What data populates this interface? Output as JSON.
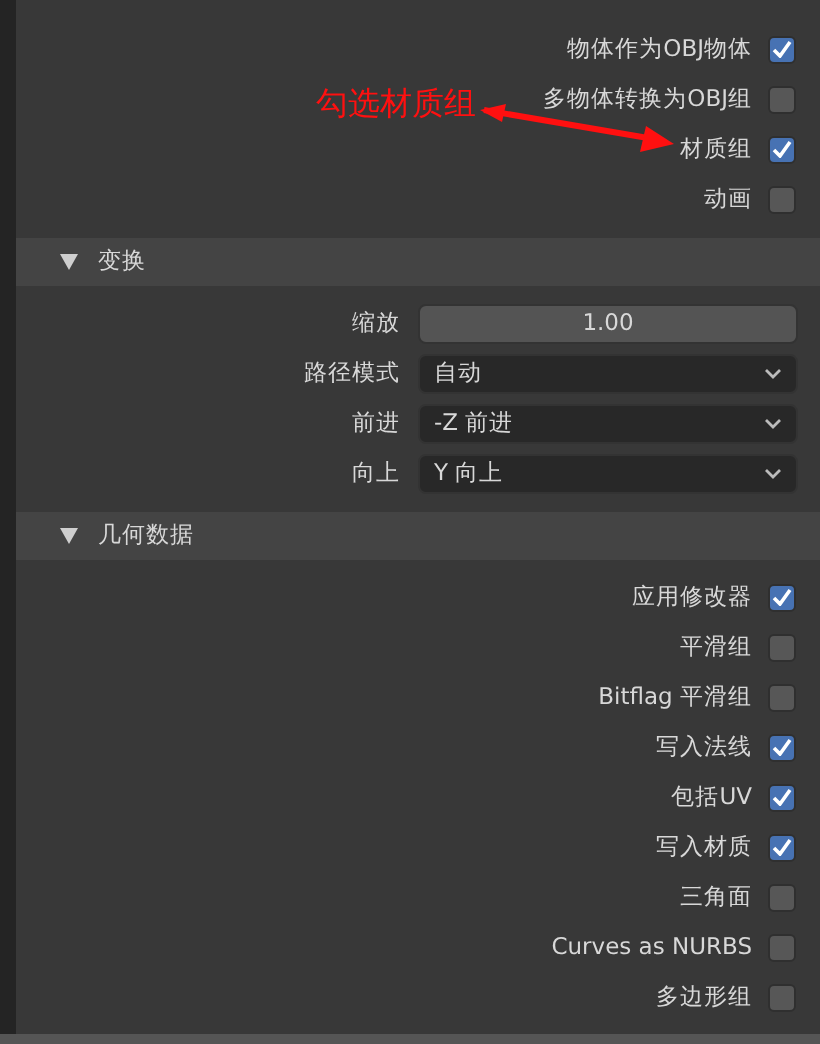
{
  "export_options": [
    {
      "label": "物体作为OBJ物体",
      "checked": true
    },
    {
      "label": "多物体转换为OBJ组",
      "checked": false
    },
    {
      "label": "材质组",
      "checked": true
    },
    {
      "label": "动画",
      "checked": false
    }
  ],
  "sections": [
    {
      "title": "变换",
      "expanded": true,
      "fields": [
        {
          "label": "缩放",
          "kind": "number",
          "value": "1.00"
        },
        {
          "label": "路径模式",
          "kind": "dropdown",
          "value": "自动"
        },
        {
          "label": "前进",
          "kind": "dropdown",
          "value": "-Z 前进"
        },
        {
          "label": "向上",
          "kind": "dropdown",
          "value": "Y 向上"
        }
      ]
    },
    {
      "title": "几何数据",
      "expanded": true,
      "options": [
        {
          "label": "应用修改器",
          "checked": true
        },
        {
          "label": "平滑组",
          "checked": false
        },
        {
          "label": "Bitflag 平滑组",
          "checked": false
        },
        {
          "label": "写入法线",
          "checked": true
        },
        {
          "label": "包括UV",
          "checked": true
        },
        {
          "label": "写入材质",
          "checked": true
        },
        {
          "label": "三角面",
          "checked": false
        },
        {
          "label": "Curves as NURBS",
          "checked": false
        },
        {
          "label": "多边形组",
          "checked": false
        }
      ]
    }
  ],
  "annotation": {
    "text": "勾选材质组"
  }
}
